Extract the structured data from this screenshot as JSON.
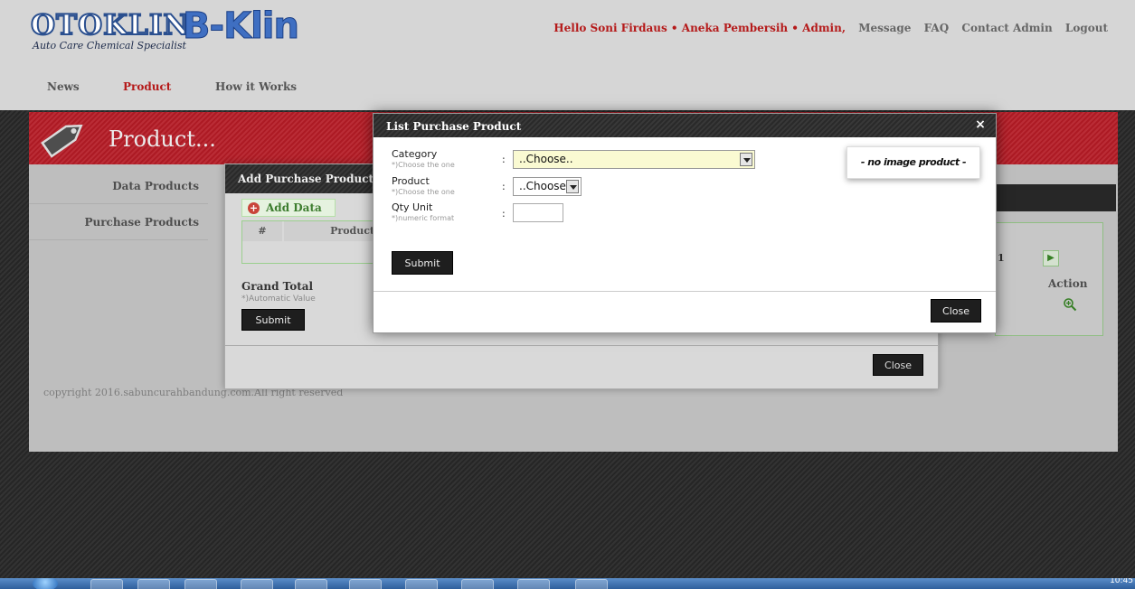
{
  "header": {
    "logo_main": "OTOKLIN",
    "logo_tagline": "Auto Care Chemical Specialist",
    "logo_brand": "B-Klin",
    "greeting": "Hello Soni Firdaus • Aneka Pembersih • Admin,",
    "links": [
      "Message",
      "FAQ",
      "Contact Admin",
      "Logout"
    ]
  },
  "nav": {
    "items": [
      {
        "label": "News",
        "active": false
      },
      {
        "label": "Product",
        "active": true
      },
      {
        "label": "How it Works",
        "active": false
      }
    ]
  },
  "banner": {
    "title": "Product..."
  },
  "sidebar": {
    "items": [
      {
        "label": "Data Products"
      },
      {
        "label": "Purchase Products"
      }
    ]
  },
  "footer": {
    "copyright": "copyright 2016.sabuncurahbandung.com.All right reserved"
  },
  "background_modal": {
    "title": "Add Purchase Product",
    "add_button": "Add Data",
    "table_headers": [
      "#",
      "Product"
    ],
    "grand_total_label": "Grand Total",
    "grand_total_hint": "*)Automatic Value",
    "submit_label": "Submit",
    "close_label": "Close"
  },
  "right_panel": {
    "page_num": "1",
    "action_label": "Action"
  },
  "modal": {
    "title": "List Purchase Product",
    "close_x": "×",
    "category_label": "Category",
    "category_hint": "*)Choose the one",
    "category_value": "..Choose..",
    "product_label": "Product",
    "product_hint": "*)Choose the one",
    "product_value": "..Choose..",
    "qty_label": "Qty Unit",
    "qty_hint": "*)numeric format",
    "qty_value": "",
    "colon": ":",
    "submit_label": "Submit",
    "close_label": "Close",
    "no_image_text": "- no image product -"
  },
  "taskbar": {
    "clock": "10:45",
    "apps": [
      "ie-icon",
      "explorer-icon",
      "media-icon",
      "firefox-icon",
      "chrome-icon",
      "opera-icon",
      "filezilla-icon",
      "excel-icon",
      "notepad-icon",
      "paint-icon",
      "word-icon"
    ]
  },
  "colors": {
    "accent_red": "#c61f2a",
    "input_highlight": "#fafad2",
    "button_dark": "#1e1e1e"
  }
}
